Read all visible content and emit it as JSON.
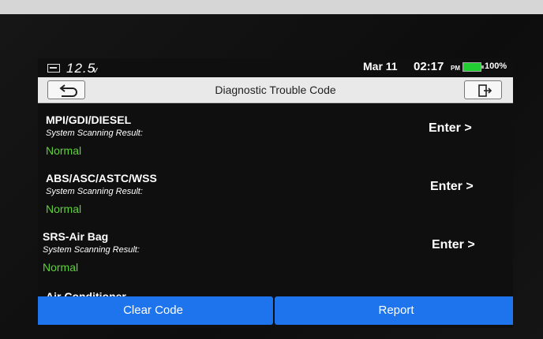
{
  "status_bar": {
    "voltage": "12.5",
    "voltage_unit": "v",
    "date": "Mar 11",
    "time": "02:17",
    "ampm": "PM",
    "battery_percent": "100%"
  },
  "title_bar": {
    "title": "Diagnostic Trouble Code"
  },
  "systems": [
    {
      "name": "MPI/GDI/DIESEL",
      "subtitle": "System Scanning Result:",
      "status": "Normal",
      "action": "Enter >"
    },
    {
      "name": "ABS/ASC/ASTC/WSS",
      "subtitle": "System Scanning Result:",
      "status": "Normal",
      "action": "Enter >"
    },
    {
      "name": "SRS-Air Bag",
      "subtitle": "System Scanning Result:",
      "status": "Normal",
      "action": "Enter >"
    }
  ],
  "partial_item": "Air Conditioner",
  "buttons": {
    "clear_code": "Clear Code",
    "report": "Report"
  },
  "colors": {
    "status_normal": "#5fd23a",
    "action_blue": "#1e74ec",
    "battery_green": "#22cc33"
  }
}
